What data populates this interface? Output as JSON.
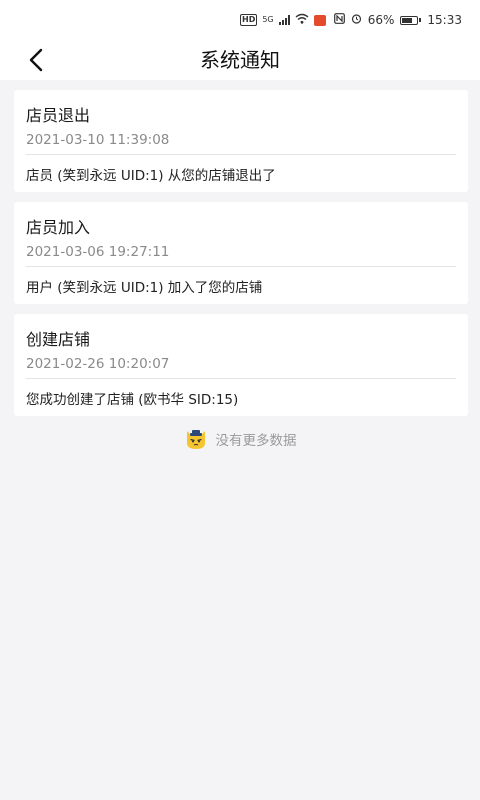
{
  "status_bar": {
    "network": "5G",
    "hd": "HD",
    "battery": "66%",
    "battery_level": 0.66,
    "time": "15:33"
  },
  "header": {
    "title": "系统通知"
  },
  "notifications": [
    {
      "title": "店员退出",
      "time": "2021-03-10 11:39:08",
      "message": "店员 (笑到永远 UID:1) 从您的店铺退出了"
    },
    {
      "title": "店员加入",
      "time": "2021-03-06 19:27:11",
      "message": "用户 (笑到永远 UID:1) 加入了您的店铺"
    },
    {
      "title": "创建店铺",
      "time": "2021-02-26 10:20:07",
      "message": "您成功创建了店铺 (欧书华 SID:15)"
    }
  ],
  "footer": {
    "empty_text": "没有更多数据"
  },
  "icons": {
    "back": "back-arrow-icon",
    "mascot": "cat-mascot-icon"
  },
  "colors": {
    "background": "#f4f4f6",
    "card": "#ffffff",
    "muted_text": "#8a8a8a",
    "mascot": "#f5c531"
  }
}
